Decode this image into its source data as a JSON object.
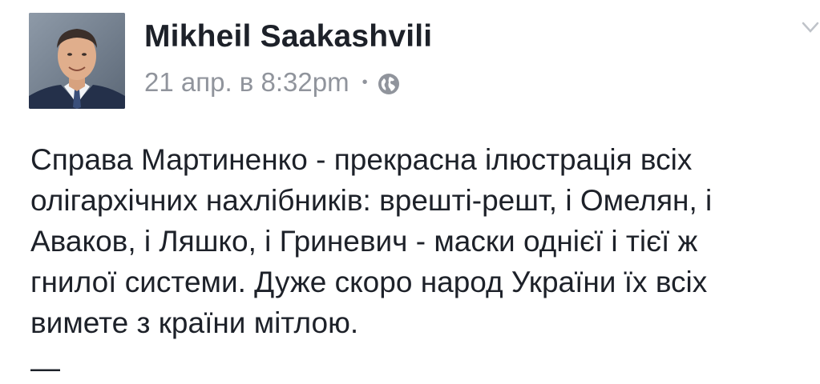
{
  "post": {
    "author": "Mikheil Saakashvili",
    "date": "21 апр. в 8:32pm",
    "separator": "•",
    "privacy_icon": "globe-icon",
    "menu_icon": "chevron-down-icon",
    "text": "Справа Мартиненко - прекрасна ілюстрація всіх\nолігархічних нахлібників: врешті-решт, і Омелян, і\nАваков, і Ляшко, і Гриневич - маски однієї і тієї ж\nгнилої системи. Дуже скоро народ України їх всіх\nвимете з країни мітлою.",
    "trailing": "—"
  },
  "colors": {
    "name": "#1d2129",
    "meta": "#90949c",
    "text": "#1d2129",
    "background": "#ffffff"
  }
}
